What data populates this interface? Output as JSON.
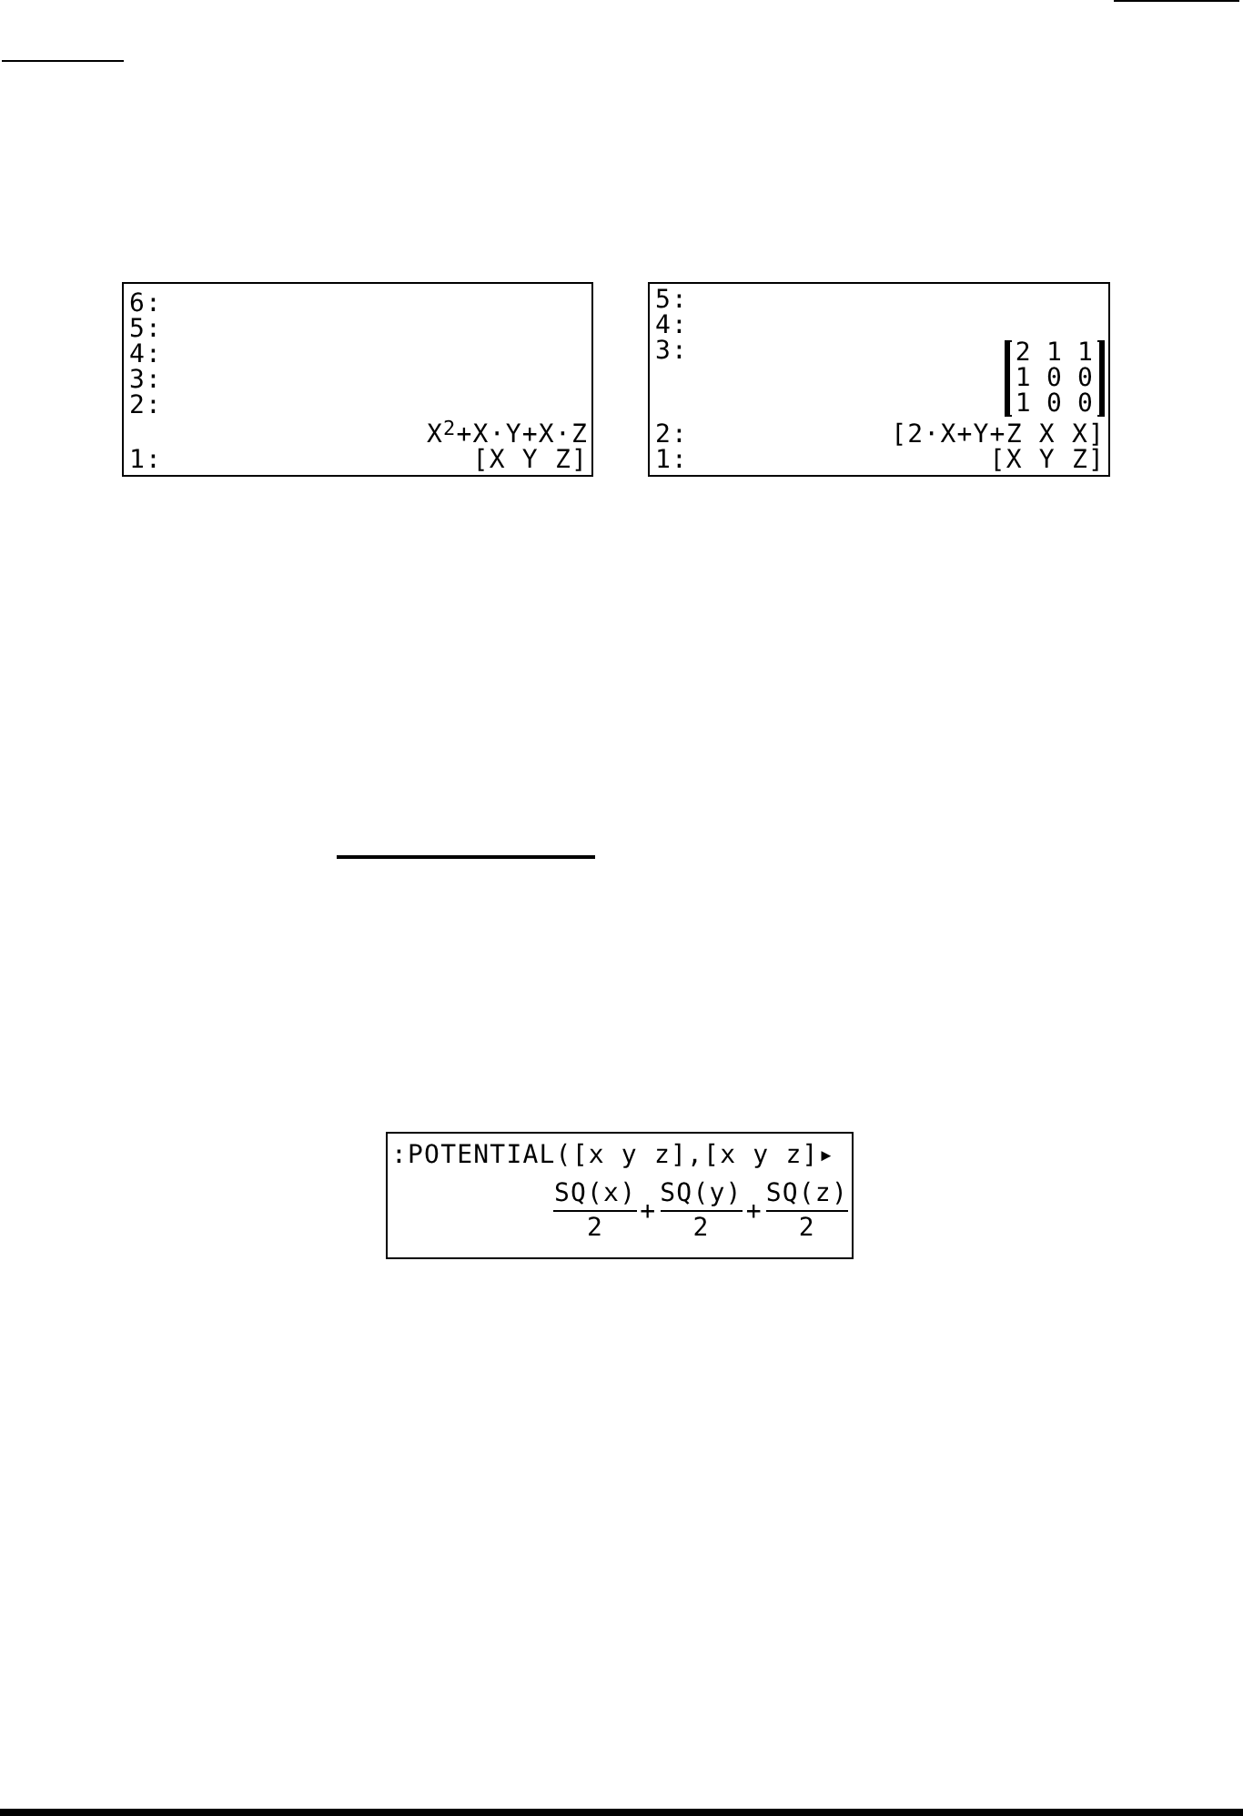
{
  "figure_1": {
    "screens": [
      {
        "kind": "stack",
        "lines": [
          {
            "label": "6:"
          },
          {
            "label": "5:"
          },
          {
            "label": "4:"
          },
          {
            "label": "3:"
          },
          {
            "label": "2:"
          },
          {
            "value": "X$^{2}$+X·Y+X·Z"
          },
          {
            "label": "1:",
            "value": "[X Y Z]"
          }
        ]
      },
      {
        "kind": "stack",
        "lines": [
          {
            "label": "5:"
          },
          {
            "label": "4:"
          },
          {
            "label": "3:",
            "matrix": [
              [
                "2",
                "1",
                "1"
              ],
              [
                "1",
                "0",
                "0"
              ],
              [
                "1",
                "0",
                "0"
              ]
            ]
          },
          {
            "label": "2:",
            "value": "[2·X+Y+Z X X]"
          },
          {
            "label": "1:",
            "value": "[X Y Z]"
          }
        ]
      }
    ]
  },
  "figure_2": {
    "screens": [
      {
        "kind": "command",
        "input": ":POTENTIAL([x y z],[x y z]▸",
        "result": [
          {
            "numerator": "SQ(x)",
            "denominator": "2"
          },
          {
            "operator": "+",
            "numerator": "SQ(y)",
            "denominator": "2"
          },
          {
            "operator": "+",
            "numerator": "SQ(z)",
            "denominator": "2"
          }
        ]
      }
    ]
  }
}
